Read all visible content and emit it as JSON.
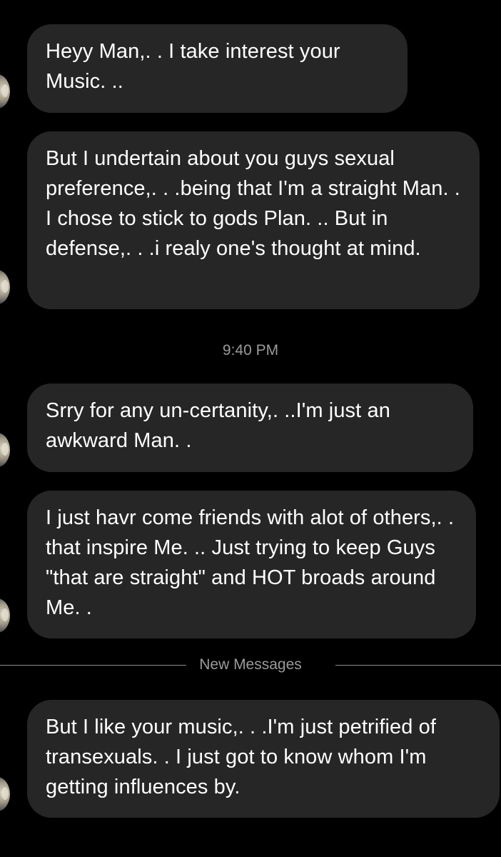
{
  "messages": [
    {
      "text": "Heyy Man,. . I take interest your Music. .."
    },
    {
      "text": "But I undertain about you guys sexual preference,. . .being that I'm a straight Man. . I chose to stick to gods Plan. .. But in defense,. . .i realy one's thought at mind."
    },
    {
      "text": "Srry for any un-certanity,. ..I'm just an awkward Man. ."
    },
    {
      "text": "I just havr come friends with alot of others,. . that inspire Me. .. Just trying to keep Guys \"that are straight\" and HOT broads around Me. ."
    },
    {
      "text": "But I like your music,. . .I'm just petrified of transexuals. . I just got to know whom I'm getting influences by."
    }
  ],
  "timestamp": "9:40 PM",
  "divider_label": "New Messages",
  "colors": {
    "background": "#000000",
    "bubble": "#262626",
    "text": "#ffffff",
    "meta_text": "#9a9a9a"
  }
}
